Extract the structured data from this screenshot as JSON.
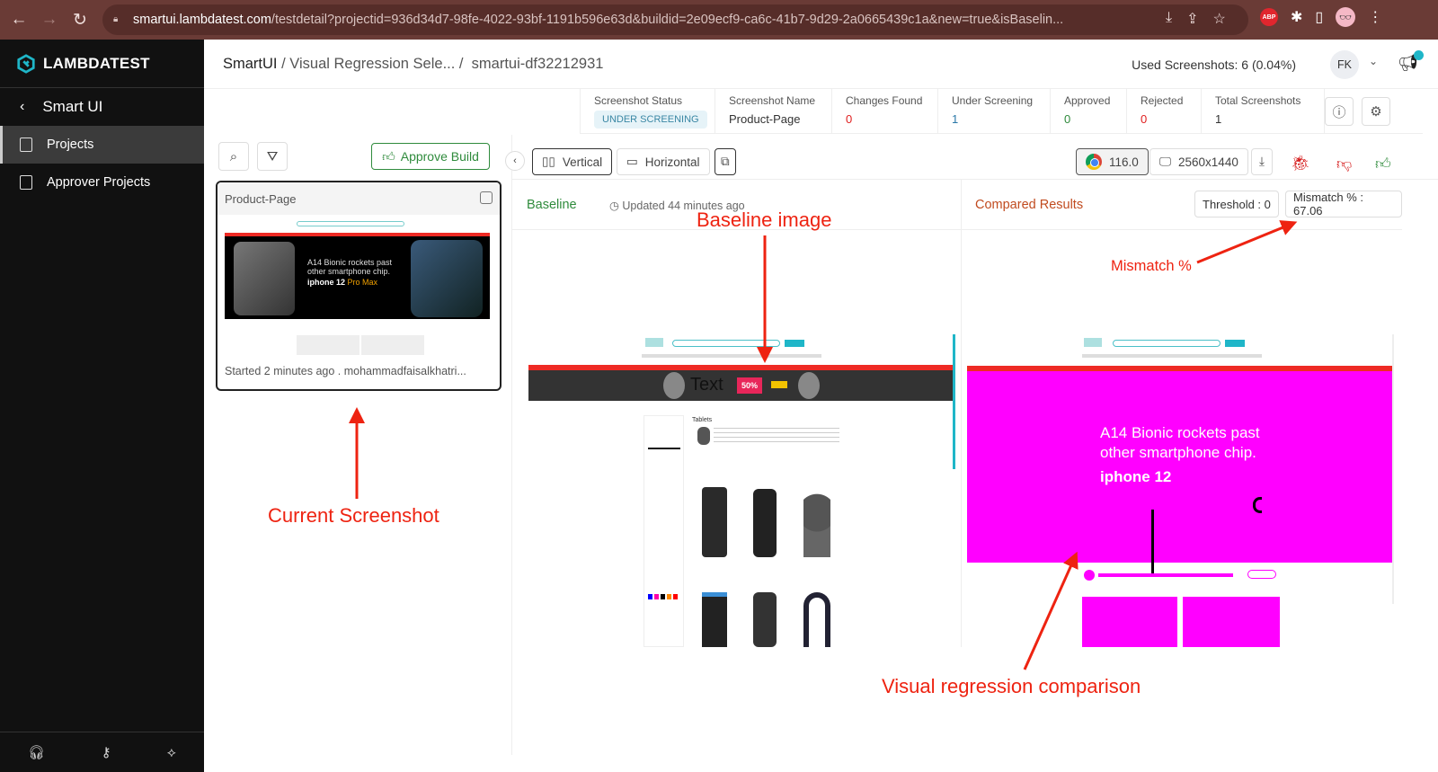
{
  "browser": {
    "url_host": "smartui.lambdatest.com",
    "url_path": "/testdetail?projectid=936d34d7-98fe-4022-93bf-1191b596e63d&buildid=2e09ecf9-ca6c-41b7-9d29-2a0665439c1a&new=true&isBaselin...",
    "extensions": [
      "ABP",
      "puzzle-icon",
      "sidebar-icon",
      "profile"
    ]
  },
  "sidebar": {
    "brand": "LAMBDATEST",
    "back_label": "Smart UI",
    "items": [
      {
        "label": "Projects",
        "active": true
      },
      {
        "label": "Approver Projects",
        "active": false
      }
    ],
    "bottom_icons": [
      "headset-icon",
      "key-icon",
      "integration-icon"
    ]
  },
  "header": {
    "breadcrumb": [
      "SmartUI",
      "Visual Regression Sele...",
      "smartui-df32212931"
    ],
    "used_screenshots": "Used Screenshots: 6 (0.04%)",
    "avatar_initials": "FK"
  },
  "stats": [
    {
      "label": "Screenshot Status",
      "value": "UNDER SCREENING",
      "type": "badge"
    },
    {
      "label": "Screenshot Name",
      "value": "Product-Page",
      "color": "#333333"
    },
    {
      "label": "Changes Found",
      "value": "0",
      "color": "#e02020"
    },
    {
      "label": "Under Screening",
      "value": "1",
      "color": "#2a78a8"
    },
    {
      "label": "Approved",
      "value": "0",
      "color": "#2f8b3c"
    },
    {
      "label": "Rejected",
      "value": "0",
      "color": "#e02020"
    },
    {
      "label": "Total Screenshots",
      "value": "1",
      "color": "#333333"
    }
  ],
  "list": {
    "approve_build_label": "Approve Build",
    "card": {
      "title": "Product-Page",
      "footer": "Started 2 minutes ago  .  mohammadfaisalkhatri...",
      "thumb_headline1": "A14 Bionic rockets past",
      "thumb_headline2": "other smartphone chip.",
      "thumb_product": "iphone 12",
      "thumb_product_accent": "Pro Max"
    }
  },
  "toolbar": {
    "vertical_label": "Vertical",
    "horizontal_label": "Horizontal",
    "browser_version": "116.0",
    "resolution": "2560x1440"
  },
  "baseline": {
    "label": "Baseline",
    "updated": "Updated 44 minutes ago",
    "banner_text": "Text",
    "banner_offer": "50%",
    "category": "Tablets"
  },
  "compared": {
    "label": "Compared Results",
    "threshold": "Threshold : 0",
    "mismatch": "Mismatch % : 67.06",
    "diff_headline1": "A14 Bionic rockets past",
    "diff_headline2": "other smartphone chip.",
    "diff_product": "iphone 12",
    "diff_color": "#ff00ff"
  },
  "annotations": {
    "baseline_image": "Baseline image",
    "current_screenshot": "Current Screenshot",
    "mismatch": "Mismatch %",
    "visual_regression": "Visual regression comparison"
  }
}
